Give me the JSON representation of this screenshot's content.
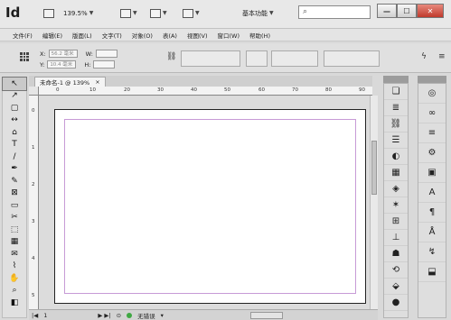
{
  "app": {
    "logo": "Id",
    "zoom_value": "139.5%",
    "workspace": "基本功能",
    "search_placeholder": ""
  },
  "window_buttons": {
    "minimize": "—",
    "restore": "☐",
    "close": "✕"
  },
  "menu": [
    "文件(F)",
    "编辑(E)",
    "版面(L)",
    "文字(T)",
    "对象(O)",
    "表(A)",
    "视图(V)",
    "窗口(W)",
    "帮助(H)"
  ],
  "control": {
    "x_label": "X:",
    "x_value": "56.2 毫米",
    "y_label": "Y:",
    "y_value": "10.4 毫米",
    "w_label": "W:",
    "w_value": "",
    "h_label": "H:",
    "h_value": ""
  },
  "document": {
    "tab_title": "未命名-1 @ 139%",
    "tab_close": "×",
    "ruler_marks": [
      "0",
      "10",
      "20",
      "30",
      "40",
      "50",
      "60",
      "70",
      "80",
      "90"
    ],
    "left_ruler_marks": [
      "0",
      "1",
      "2",
      "3",
      "4",
      "5"
    ]
  },
  "status": {
    "page_number": "1",
    "preflight": "无错误"
  },
  "tools": [
    {
      "name": "selection-tool-icon",
      "glyph": "↖"
    },
    {
      "name": "direct-selection-tool-icon",
      "glyph": "↗"
    },
    {
      "name": "page-tool-icon",
      "glyph": "▢"
    },
    {
      "name": "gap-tool-icon",
      "glyph": "↔"
    },
    {
      "name": "content-collector-icon",
      "glyph": "⌂"
    },
    {
      "name": "type-tool-icon",
      "glyph": "T"
    },
    {
      "name": "line-tool-icon",
      "glyph": "/"
    },
    {
      "name": "pen-tool-icon",
      "glyph": "✒"
    },
    {
      "name": "pencil-tool-icon",
      "glyph": "✎"
    },
    {
      "name": "rectangle-frame-tool-icon",
      "glyph": "⊠"
    },
    {
      "name": "rectangle-tool-icon",
      "glyph": "▭"
    },
    {
      "name": "scissors-tool-icon",
      "glyph": "✂"
    },
    {
      "name": "free-transform-tool-icon",
      "glyph": "⬚"
    },
    {
      "name": "gradient-tool-icon",
      "glyph": "▦"
    },
    {
      "name": "note-tool-icon",
      "glyph": "✉"
    },
    {
      "name": "eyedropper-tool-icon",
      "glyph": "⌇"
    },
    {
      "name": "hand-tool-icon",
      "glyph": "✋"
    },
    {
      "name": "zoom-tool-icon",
      "glyph": "⌕"
    },
    {
      "name": "fill-stroke-icon",
      "glyph": "◧"
    }
  ],
  "panel_left": [
    {
      "name": "pages-panel-icon",
      "glyph": "❏"
    },
    {
      "name": "layers-panel-icon",
      "glyph": "≣"
    },
    {
      "name": "links-panel-icon",
      "glyph": "⛓"
    },
    {
      "name": "stroke-panel-icon",
      "glyph": "☰"
    },
    {
      "name": "color-panel-icon",
      "glyph": "◐"
    },
    {
      "name": "swatches-panel-icon",
      "glyph": "▦"
    },
    {
      "name": "gradient-panel-icon",
      "glyph": "◈"
    },
    {
      "name": "effects-panel-icon",
      "glyph": "✶"
    },
    {
      "name": "text-wrap-panel-icon",
      "glyph": "⊞"
    },
    {
      "name": "align-panel-icon",
      "glyph": "⊥"
    },
    {
      "name": "object-styles-panel-icon",
      "glyph": "☗"
    },
    {
      "name": "cc-libraries-panel-icon",
      "glyph": "⟲"
    },
    {
      "name": "transform-panel-icon",
      "glyph": "⬙"
    },
    {
      "name": "info-panel-icon",
      "glyph": "●"
    }
  ],
  "panel_right": [
    {
      "name": "paragraph-panel-icon",
      "glyph": "◎"
    },
    {
      "name": "hyperlinks-panel-icon",
      "glyph": "∞"
    },
    {
      "name": "tables-panel-icon",
      "glyph": "≡"
    },
    {
      "name": "character-panel-icon",
      "glyph": "⚙"
    },
    {
      "name": "table-styles-panel-icon",
      "glyph": "▣"
    },
    {
      "name": "character-styles-panel-icon",
      "glyph": "A"
    },
    {
      "name": "paragraph-styles-panel-icon",
      "glyph": "¶"
    },
    {
      "name": "glyphs-panel-icon",
      "glyph": "Å"
    },
    {
      "name": "story-panel-icon",
      "glyph": "↯"
    },
    {
      "name": "cell-styles-panel-icon",
      "glyph": "⬓"
    }
  ]
}
